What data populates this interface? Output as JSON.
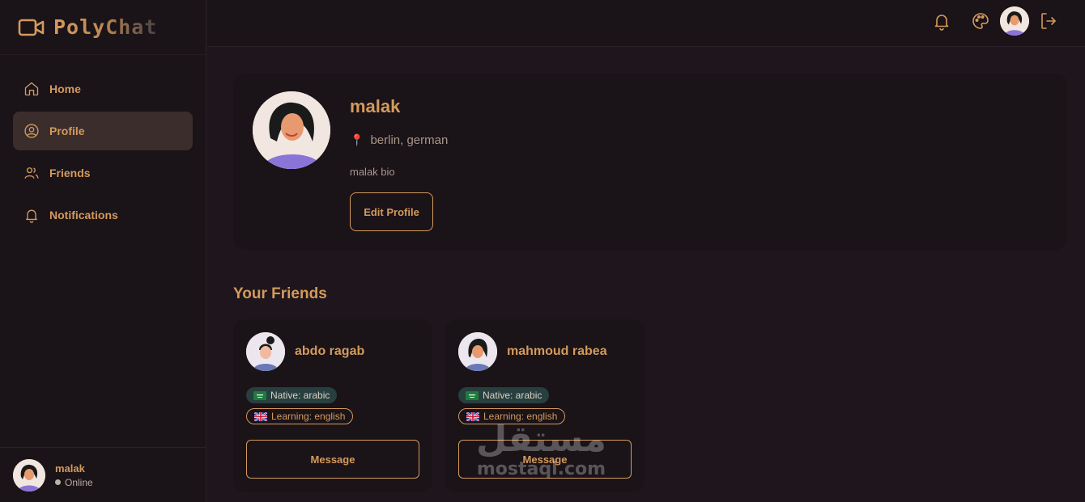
{
  "app": {
    "name": "PolyChat"
  },
  "sidebar": {
    "items": [
      {
        "label": "Home",
        "icon": "home-icon"
      },
      {
        "label": "Profile",
        "icon": "user-circle-icon",
        "active": true
      },
      {
        "label": "Friends",
        "icon": "users-icon"
      },
      {
        "label": "Notifications",
        "icon": "bell-icon"
      }
    ],
    "user": {
      "name": "malak",
      "status": "Online"
    }
  },
  "topbar": {
    "icons": [
      "bell-icon",
      "palette-icon",
      "avatar",
      "logout-icon"
    ]
  },
  "profile": {
    "name": "malak",
    "location": "berlin, german",
    "bio": "malak bio",
    "edit_label": "Edit Profile"
  },
  "friends": {
    "title": "Your Friends",
    "list": [
      {
        "name": "abdo ragab",
        "native": "Native: arabic",
        "learning": "Learning: english",
        "message_label": "Message"
      },
      {
        "name": "mahmoud rabea",
        "native": "Native: arabic",
        "learning": "Learning: english",
        "message_label": "Message"
      }
    ]
  },
  "watermark": {
    "arabic": "مستقل",
    "latin": "mostaql.com"
  },
  "colors": {
    "accent": "#d49a5c",
    "background": "#1e161c",
    "card": "#1a1318",
    "active_nav": "#3a2d2b",
    "native_badge": "#27403f"
  }
}
